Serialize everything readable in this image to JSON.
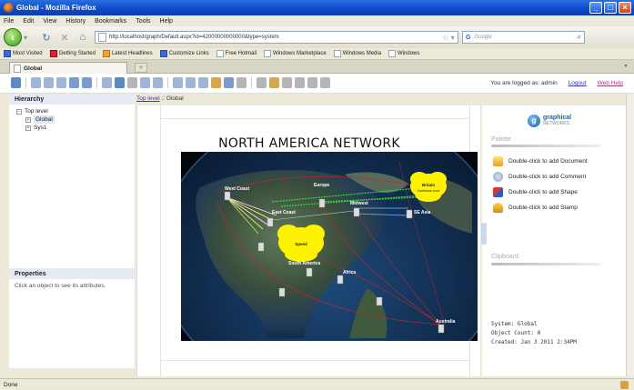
{
  "window": {
    "title": "Global - Mozilla Firefox"
  },
  "menu": [
    "File",
    "Edit",
    "View",
    "History",
    "Bookmarks",
    "Tools",
    "Help"
  ],
  "nav": {
    "url": "http://localhost/graph/Default.aspx?id=42000000000000&type=system",
    "search_placeholder": "Google",
    "search_engine": "G"
  },
  "bookmarks": [
    "Most Visited",
    "Getting Started",
    "Latest Headlines",
    "Customize Links",
    "Free Hotmail",
    "Windows Marketplace",
    "Windows Media",
    "Windows"
  ],
  "tab": {
    "label": "Global",
    "new_tab": "+"
  },
  "app": {
    "login_text": "You are logged as: admin",
    "logout": "Logout",
    "help": "Web Help",
    "breadcrumb_link": "Top level",
    "breadcrumb_sep": "::",
    "breadcrumb_current": "Global"
  },
  "hierarchy": {
    "title": "Hierarchy",
    "items": [
      {
        "label": "Top level"
      },
      {
        "label": "Global"
      },
      {
        "label": "Sys1"
      }
    ]
  },
  "properties": {
    "title": "Properties",
    "hint": "Click an object to see its attributes."
  },
  "canvas": {
    "title": "NORTH AMERICA NETWORK",
    "map_labels": {
      "west_coast": "West Coast",
      "europe": "Europe",
      "east_coast": "East Coast",
      "midwest": "Midwest",
      "se_asia": "SE Asia",
      "south_america": "South America",
      "africa": "Africa",
      "australia": "Australia",
      "cloud_yellow_small": "Britain",
      "cloud_yellow_small_sub": "Caribbean zone",
      "cloud_yellow_large": "Speed"
    }
  },
  "right_panel": {
    "brand": "graphical",
    "brand_sub": "NETWORKS",
    "palette_title": "Palette",
    "palette_items": [
      {
        "label": "Double-click to add Document",
        "icon": "document-icon"
      },
      {
        "label": "Double-click to add Comment",
        "icon": "comment-icon"
      },
      {
        "label": "Double-click to add Shape",
        "icon": "shape-icon"
      },
      {
        "label": "Double-click to add Stamp",
        "icon": "stamp-icon"
      }
    ],
    "clipboard_title": "Clipboard",
    "system_label": "System: Global",
    "object_count": "Object Count: 0",
    "created": "Created: Jan 3 2011 2:34PM"
  },
  "status": {
    "text": "Done"
  }
}
